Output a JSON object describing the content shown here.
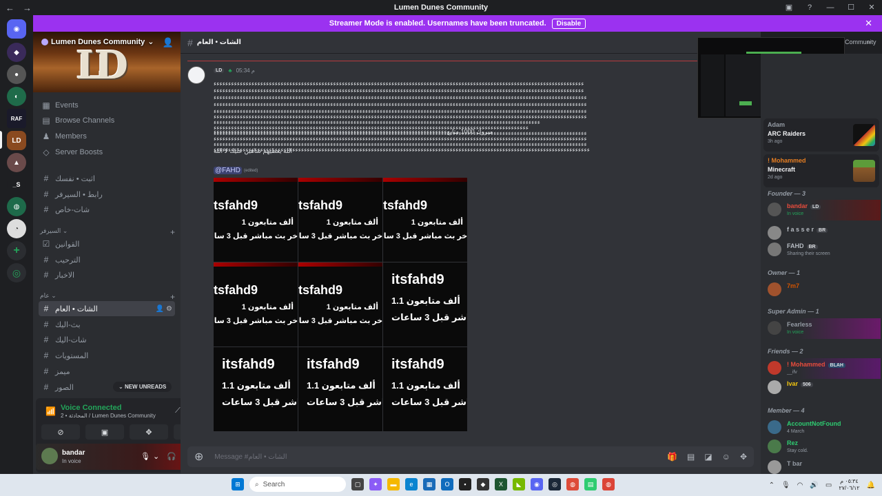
{
  "window": {
    "title": "Lumen Dunes Community",
    "back": "←",
    "forward": "→",
    "controls": [
      "▣",
      "?",
      "—",
      "☐",
      "✕"
    ]
  },
  "banner": {
    "text": "Streamer Mode is enabled. Usernames have been truncated.",
    "button": "Disable",
    "close": "✕"
  },
  "server": {
    "name": "Lumen Dunes Community",
    "logo": "LD"
  },
  "sidebar": {
    "top_items": [
      {
        "label": "Events",
        "icon": "calendar-icon"
      },
      {
        "label": "Browse Channels",
        "icon": "browse-icon"
      },
      {
        "label": "Members",
        "icon": "members-icon"
      },
      {
        "label": "Server Boosts",
        "icon": "boost-icon"
      }
    ],
    "channels_a": [
      "اثبت • نفسك",
      "رابط • السيرفر",
      "شات-خاص"
    ],
    "category_server": "السيرفر",
    "channels_b": [
      "القوانين",
      "الترحيب",
      "الاخبار"
    ],
    "category_general": "عام",
    "channels_c": [
      "الشات • العام",
      "بث-اليك",
      "شات-اليك",
      "المستويات",
      "ميمز",
      "الصور"
    ],
    "new_unreads": "NEW UNREADS"
  },
  "voice": {
    "title": "Voice Connected",
    "subtitle": "2 • المحادثة / Lumen Dunes Community"
  },
  "user": {
    "name": "bandar",
    "status": "In voice"
  },
  "channel": {
    "name": "الشات • العام"
  },
  "message": {
    "badge": "LD",
    "time": "05:34 م",
    "lines": [
      "ءءءءءءءءءءءءءءءءءءءءءءءءءءءءءءءءءءءءءءءءءءءءءءءءءءءءءءءءءءءءءءءءءءءءءءءءءءءءءءءءءءءءءءءءءءءءءءءءءءءءءءءءءءءءءءءءءءءءءءءءءءءءءءء",
      "ءءءءءءءءءءءءءءءءءءءءءءءءءءءءءءءءءءءءءءءءءءءءءءءءءءءءءءءءءءءءءءءءءءءءءءءءءءءءءءءءءءءءءءءءءءءءءءءءءءءءءءءءءءءءءءءءءءءءءءءءءءءءءءء",
      "ءءءءءءءءءءءءءءءءءءءءءءءءءءءءءءءءءءءءءءءءءءءءءءءءءءءءءءءءءءءءءءءءءءءءءءءءءءءءءءءءءءءءءءءءءءءءءءءءءءءءءءءءءءءءءءءءءءءءءءءءءءءءءءءء",
      "ءءءءءءءءءءءءءءءءءءءءءءءءءءءءءءءءءءءءءءءءءءءءءءءءءءءءءءءءءءءءءءءءءءءءءءءءءءءءءءءءءءءءءءءءءءءءءءءءءءءءءءءءءءءءءءءءءءءءءءءءءءءءءءءء",
      "ءءءءءءءءءءءءءءءءءءءءءءءءءءءءءءءءءءءءءءءءءءءءءءءءءءءءءءءءءءءءءءءءءءءءءءءءءءءءءءءءءءءءءءءءءءءءءءءءءءءءءءءءءءءءءءءءءءءءءءءءءءءءءءءء",
      "ءءءءءءءءءءءءءءءءءءءءءءءءءءءءءءءءءءءءءءءءءءءءءءءءءءءءءءءءءءءءءءءءءءءءءءءءءءءءءءءءءءءءءءءءءءءءءءءءءءءءءءءءءءءءءءءءءءءءءءءءءءءءءءءء",
      "ءءءءءءءءءءءءءءءءءءءءءءءءءءءءءءءءءءءءءءءءءءءءءءءءءءءءءءءءءءءءءءءءءءءءءءءءءءءءءءءءءءءءءءءءءءءءءءءءءءءءءءءءءءءءءءءء",
      "ءءءءءءءءءءءءءءءءءءءءءءءءءءءءءءءءءءءءءءءءءءءءءءءءءءءءءءءءءءءءءءءءءءءءءءءءءءءءءءءءءءءءءءءءءءءءءءءءءءءءءءءءءءءء",
      "ءءءءءءءءءءءءءءءءءءءءءءءءءءءءءءءءءءءءءءءءءءءءءءءءءءءءءءءءءءءءءءءءءءءءءءءءءءءءءءءءءءءءءءءءءءءءءءءءءءءءءءءءءءءءءءءءءءءءءءءءءءءءءءءء",
      "ءءءءءءءءءءءءءءءءءءءءءءءءءءءءءءءءءءءءءءءءءءءءءءءءءءءءءءءءءءءءءءءءءءءءءءءءءءءءءءءءءءءءءءءءءءءءءءءءءءءءءءءءءءءءءءءءءءءءءءءءءءءءءءءء",
      "ءءءءءءءءءءءءءءءءءءءءءءءءءءءءءءءءءءءءءءءءءءءءءءءءءءءءءءءءءءءءءءءءءءءءءءءءءءءءءءءءءءءءءءءءءءءءءءءءءءءءءءءءءءءءءءءءءءءءءءءءءءءءءءءء",
      "ءءءءءءءءءءءءءءءءءءءءءءءءءءءءءءءءءءءءءءءءءءءءءءءءءءءءءءءءءءءءءءءءءءءءءءءءءءءءءءءءءءءءءءءءءءءءءءءءءءءءءءءءءءءءءءءءءءءءءءءءءءءءءءءءء",
      "مبروك 1000 متابعءءءءءءءءءءءءءءءءءءءءءءءءءءءءءءءءءءءءءءءءءءءءءءءءءءءءءءءءءءءءءءءءءءءءءءءءءءءءءءءء"
    ],
    "line2": "الله يعطيهم شاهين عليك لا الله",
    "mention": "@FAHD",
    "edited": "(edited)",
    "tiles": [
      {
        "handle": "tsfahd9",
        "followers": "ألف متابعون 1",
        "last": "آخر بث مباشر قبل 3 ساعات"
      },
      {
        "handle": "tsfahd9",
        "followers": "ألف متابعون 1",
        "last": "آخر بث مباشر قبل 3 ساعات"
      },
      {
        "handle": "tsfahd9",
        "followers": "ألف متابعون 1",
        "last": "آخر بث مباشر قبل 3 ساعات"
      },
      {
        "handle": "tsfahd9",
        "followers": "ألف متابعون 1",
        "last": "آخر بث مباشر قبل 3 ساعات"
      },
      {
        "handle": "tsfahd9",
        "followers": "ألف متابعون 1",
        "last": "آخر بث مباشر قبل 3 ساعات"
      },
      {
        "handle": "itsfahd9",
        "followers": "ألف متابعون 1.1",
        "last": "باشر قبل 3 ساعات"
      },
      {
        "handle": "itsfahd9",
        "followers": "ألف متابعون 1.1",
        "last": "باشر قبل 3 ساعات"
      },
      {
        "handle": "itsfahd9",
        "followers": "ألف متابعون 1.1",
        "last": "باشر قبل 3 ساعات"
      },
      {
        "handle": "itsfahd9",
        "followers": "ألف متابعون 1.1",
        "last": "باشر قبل 3 ساعات"
      }
    ]
  },
  "input": {
    "placeholder": "Message #الشات • العام"
  },
  "activity": [
    {
      "who": "Adam",
      "game": "ARC Raiders",
      "when": "3h ago"
    },
    {
      "who": "! Mohammed",
      "game": "Minecraft",
      "when": "2d ago"
    }
  ],
  "roles": {
    "founder": "Founder — 3",
    "owner": "Owner — 1",
    "super_admin": "Super Admin — 1",
    "friends": "Friends — 2",
    "member": "Member — 4"
  },
  "members": {
    "bandar": {
      "name": "bandar",
      "tag": "LD",
      "status": "In voice"
    },
    "fasser": {
      "name": "f a s s e r",
      "tag": "BR"
    },
    "fahd": {
      "name": "FAHD",
      "tag": "BR",
      "status": "Sharing their screen"
    },
    "owner": {
      "name": "7m7"
    },
    "fearless": {
      "name": "Fearless",
      "status": "In voice"
    },
    "mohammed": {
      "name": "! Mohammed",
      "tag": "BLAH",
      "status": "__ifv"
    },
    "ivar": {
      "name": "Ivar",
      "tag": "506"
    },
    "accountnotfound": {
      "name": "AccountNotFound",
      "status": "4 March"
    },
    "rez": {
      "name": "Rez",
      "status": "Stay cold."
    },
    "last": {
      "name": "T bar"
    }
  },
  "search_hint": "Community",
  "taskbar": {
    "search": "Search",
    "clock_time": "٠٥:٣٤ م",
    "clock_date": "٢٧/٠٦/١٢"
  },
  "colors": {
    "accent": "#9b32f0",
    "green": "#23a55a",
    "bg": "#313338",
    "sidebar": "#2b2d31"
  }
}
